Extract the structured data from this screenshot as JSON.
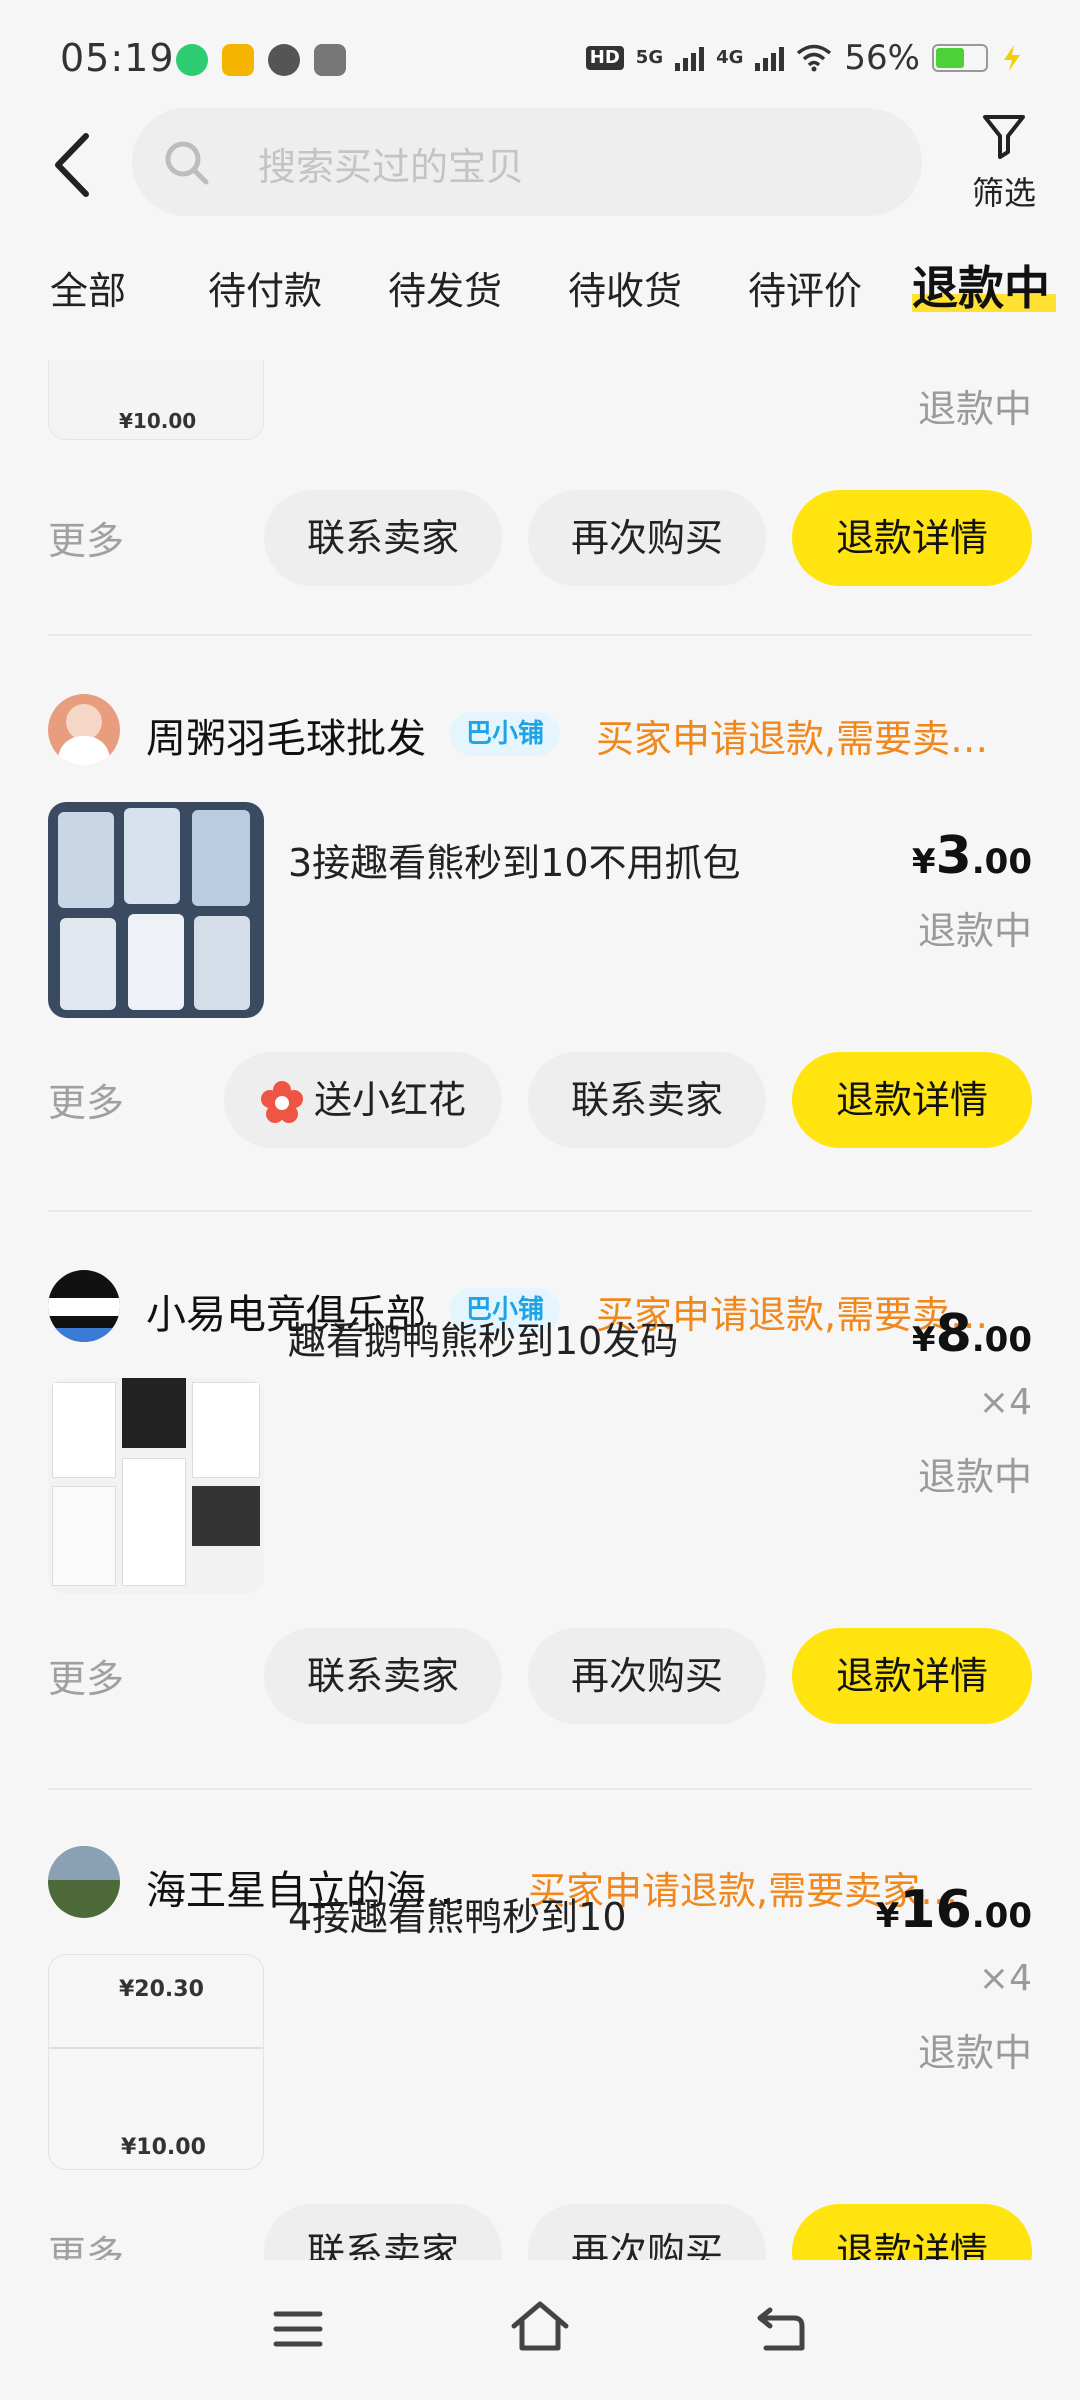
{
  "status_bar": {
    "time": "05:19",
    "network_1": "HD",
    "network_2": "5G",
    "network_3": "4G",
    "battery": "56%",
    "battery_color": "#4cd137"
  },
  "search": {
    "placeholder": "搜索买过的宝贝"
  },
  "filter": {
    "label": "筛选"
  },
  "tabs": [
    {
      "label": "全部"
    },
    {
      "label": "待付款"
    },
    {
      "label": "待发货"
    },
    {
      "label": "待收货"
    },
    {
      "label": "待评价"
    },
    {
      "label": "退款中",
      "active": true
    }
  ],
  "colors": {
    "accent": "#ffe40f",
    "status": "#f0881c",
    "badge_text": "#1ea3e6"
  },
  "orders": [
    {
      "thumb_text": "¥10.00",
      "state": "退款中",
      "actions": {
        "more": "更多",
        "b1": "联系卖家",
        "b2": "再次购买",
        "b3": "退款详情"
      }
    },
    {
      "shop": "周粥羽毛球批发",
      "badge": "巴小铺",
      "status": "买家申请退款,需要卖…",
      "title": "3接趣看熊秒到10不用抓包",
      "price_symbol": "¥",
      "price_int": "3",
      "price_dec": ".00",
      "state": "退款中",
      "actions": {
        "more": "更多",
        "b1": "送小红花",
        "b2": "联系卖家",
        "b3": "退款详情"
      }
    },
    {
      "shop": "小易电竞俱乐部",
      "badge": "巴小铺",
      "status": "买家申请退款,需要卖…",
      "title": "趣看鹅鸭熊秒到10发码",
      "price_symbol": "¥",
      "price_int": "8",
      "price_dec": ".00",
      "qty": "×4",
      "state": "退款中",
      "actions": {
        "more": "更多",
        "b1": "联系卖家",
        "b2": "再次购买",
        "b3": "退款详情"
      }
    },
    {
      "shop": "海王星自立的海…",
      "status": "买家申请退款,需要卖家…",
      "title": "4接趣看熊鸭秒到10",
      "thumb_text_1": "¥20.30",
      "thumb_text_2": "¥10.00",
      "price_symbol": "¥",
      "price_int": "16",
      "price_dec": ".00",
      "qty": "×4",
      "state": "退款中",
      "actions": {
        "more": "更多",
        "b1": "联系卖家",
        "b2": "再次购买",
        "b3": "退款详情"
      }
    }
  ]
}
